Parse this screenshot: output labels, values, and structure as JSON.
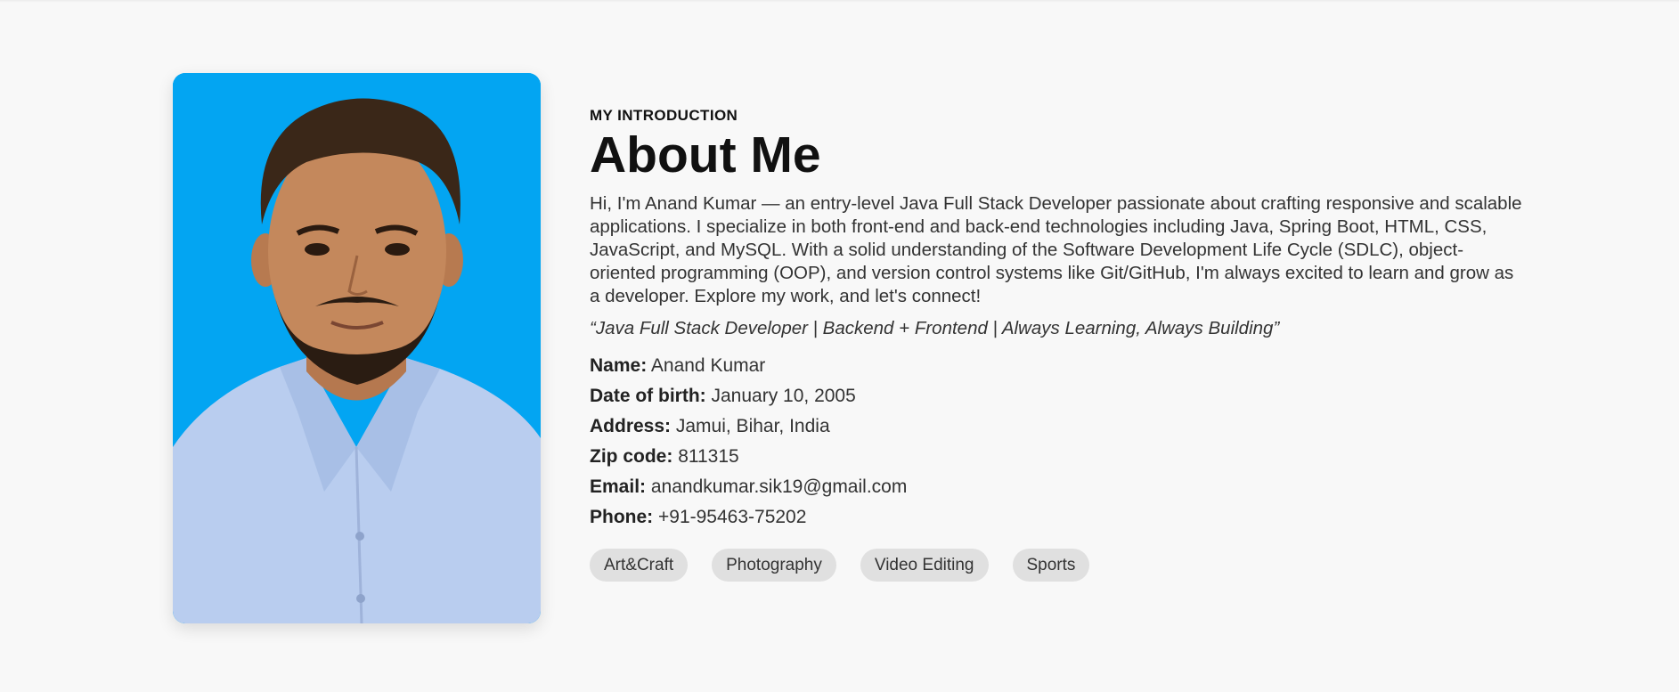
{
  "about": {
    "subheading": "MY INTRODUCTION",
    "title": "About Me",
    "intro": "Hi, I'm Anand Kumar — an entry-level Java Full Stack Developer passionate about crafting responsive and scalable applications. I specialize in both front-end and back-end technologies including Java, Spring Boot, HTML, CSS, JavaScript, and MySQL. With a solid understanding of the Software Development Life Cycle (SDLC), object-oriented programming (OOP), and version control systems like Git/GitHub, I'm always excited to learn and grow as a developer. Explore my work, and let's connect!",
    "tagline": "“Java Full Stack Developer | Backend + Frontend | Always Learning, Always Building”",
    "details": [
      {
        "key": "Name:",
        "value": "Anand Kumar"
      },
      {
        "key": "Date of birth:",
        "value": "January 10, 2005"
      },
      {
        "key": "Address:",
        "value": "Jamui, Bihar, India"
      },
      {
        "key": "Zip code:",
        "value": "811315"
      },
      {
        "key": "Email:",
        "value": "anandkumar.sik19@gmail.com"
      },
      {
        "key": "Phone:",
        "value": "+91-95463-75202"
      }
    ],
    "hobbies": [
      "Art&Craft",
      "Photography",
      "Video Editing",
      "Sports"
    ]
  },
  "colors": {
    "background": "#f8f8f8",
    "photo_background": "#03a5f2",
    "tag_background": "#e0e0e0",
    "shirt": "#b9cdef"
  }
}
